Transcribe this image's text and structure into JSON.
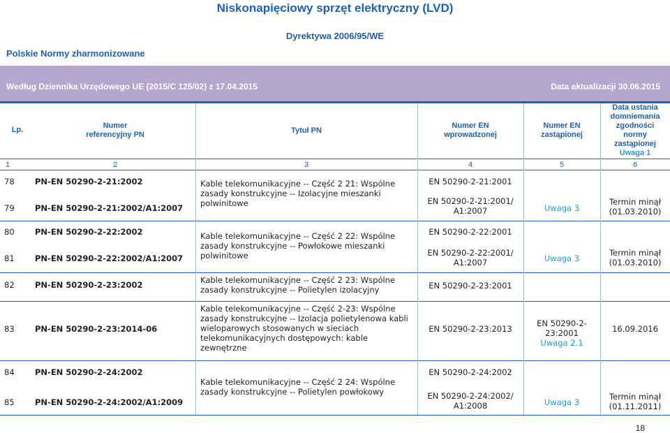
{
  "page_title": "Niskonapięciowy sprzęt elektryczny (LVD)",
  "directive": "Dyrektywa 2006/95/WE",
  "section_title": "Polskie Normy zharmonizowane",
  "journal": "Według Dziennika Urzędowego UE (2015/C 125/02) z 17.04.2015",
  "update_date": "Data aktualizacji 30.06.2015",
  "headers": {
    "lp": "Lp.",
    "numer_pn_1": "Numer",
    "numer_pn_2": "referencyjny PN",
    "tytul": "Tytuł PN",
    "en_wpr_1": "Numer EN",
    "en_wpr_2": "wprowadzonej",
    "en_zast_1": "Numer EN",
    "en_zast_2": "zastąpionej",
    "data_1": "Data ustania",
    "data_2": "domniemania",
    "data_3": "zgodności",
    "data_4": "normy",
    "data_5": "zastąpionej",
    "data_6": "Uwaga 1"
  },
  "col_numbers": [
    "1",
    "2",
    "3",
    "4",
    "5",
    "6"
  ],
  "rows": [
    {
      "lp": "78",
      "pn": "PN-EN 50290-2-21:2002",
      "en": "EN 50290-2-21:2001"
    },
    {
      "lp": "79",
      "pn": "PN-EN 50290-2-21:2002/A1:2007",
      "en_1": "EN 50290-2-21:2001/",
      "en_2": "A1:2007"
    },
    {
      "lp": "80",
      "pn": "PN-EN 50290-2-22:2002",
      "en": "EN 50290-2-22:2001"
    },
    {
      "lp": "81",
      "pn": "PN-EN 50290-2-22:2002/A1:2007",
      "en_1": "EN 50290-2-22:2001/",
      "en_2": "A1:2007"
    },
    {
      "lp": "82",
      "pn": "PN-EN 50290-2-23:2002",
      "en": "EN 50290-2-23:2001"
    },
    {
      "lp": "83",
      "pn": "PN-EN 50290-2-23:2014-06",
      "en": "EN 50290-2-23:2013"
    },
    {
      "lp": "84",
      "pn": "PN-EN 50290-2-24:2002",
      "en": "EN 50290-2-24:2002"
    },
    {
      "lp": "85",
      "pn": "PN-EN 50290-2-24:2002/A1:2009",
      "en_1": "EN 50290-2-24:2002/",
      "en_2": "A1:2008"
    }
  ],
  "titles": {
    "g1": [
      "Kable telekomunikacyjne -- Część 2 21: Wspólne",
      "zasady konstrukcyjne -- Izolacyjne mieszanki",
      "polwinitowe"
    ],
    "g2": [
      "Kable telekomunikacyjne -- Część 2 22: Wspólne",
      "zasady konstrukcyjne -- Powłokowe mieszanki",
      "polwinitowe"
    ],
    "g3": [
      "Kable telekomunikacyjne -- Część 2 23: Wspólne",
      "zasady konstrukcyjne -- Polietylen izolacyjny"
    ],
    "g4": [
      "Kable telekomunikacyjne -- Część 2-23: Wspólne",
      "zasady konstrukcyjne -- Izolacja polietylenowa kabli",
      "wieloparowych stosowanych w sieciach",
      "telekomunikacyjnych dostępowych: kable",
      "zewnętrzne"
    ],
    "g5": [
      "Kable telekomunikacyjne -- Część 2 24: Wspólne",
      "zasady konstrukcyjne -- Polietylen powłokowy"
    ]
  },
  "replaced": {
    "uwaga3": "Uwaga 3",
    "r83_en": "EN 50290-2-23:2001",
    "r83_note": "Uwaga 2.1"
  },
  "dates": {
    "termin": "Termin minął",
    "d79": "(01.03.2010)",
    "d81": "(01.03.2010)",
    "d83": "16.09.2016",
    "d85": "(01.11.2011)"
  },
  "page_number": "18"
}
